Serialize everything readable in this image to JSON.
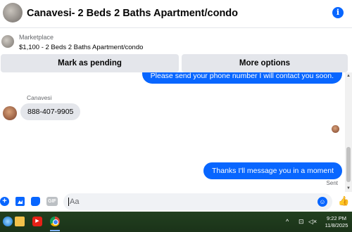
{
  "header": {
    "title": "Canavesi- 2 Beds 2 Baths Apartment/condo",
    "info_icon": "info-icon"
  },
  "listing": {
    "label": "Marketplace",
    "price_title": "$1,100 - 2 Beds 2 Baths Apartment/condo"
  },
  "actions": {
    "mark_pending": "Mark as pending",
    "more_options": "More options"
  },
  "messages": {
    "outgoing_top": "Please send your phone number I will contact you soon.",
    "sender_name": "Canavesi",
    "incoming": "888-407-9905",
    "outgoing_bottom": "Thanks I'll message you in a moment",
    "status": "Sent"
  },
  "composer": {
    "placeholder": "Aa",
    "gif_label": "GIF",
    "icons": [
      "plus-icon",
      "photo-icon",
      "sticker-icon",
      "gif-icon",
      "emoji-icon",
      "like-icon"
    ]
  },
  "taskbar": {
    "time": "9:22 PM",
    "date": "11/8/2025",
    "icons": [
      "start-icon",
      "file-explorer-icon",
      "youtube-icon",
      "chrome-icon",
      "tray-chevron-icon",
      "network-icon",
      "volume-icon"
    ]
  },
  "colors": {
    "accent": "#0866ff",
    "bubble_in": "#e4e6eb",
    "taskbar": "#1d3a1f"
  }
}
